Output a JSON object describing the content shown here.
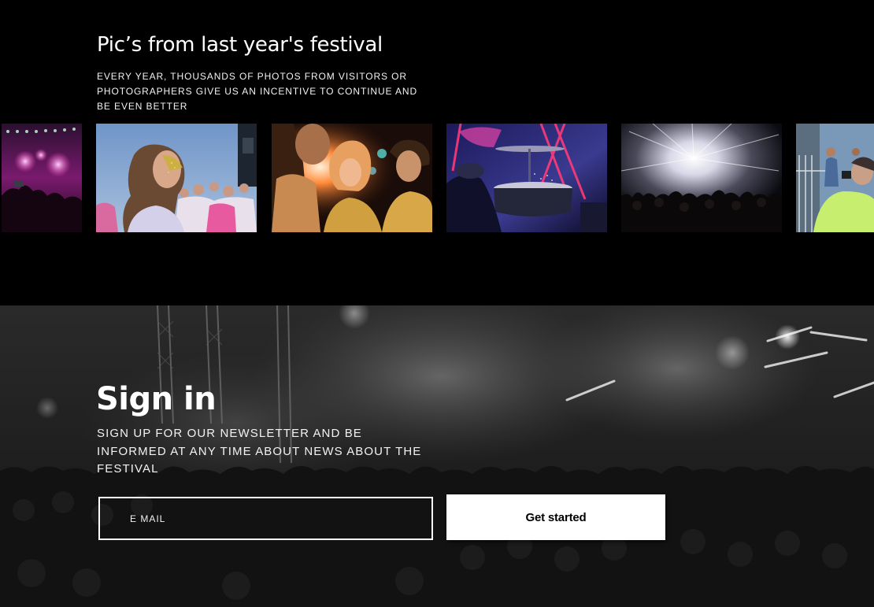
{
  "gallery": {
    "title": "Pic’s from last year's festival",
    "subtitle": "EVERY YEAR, THOUSANDS OF PHOTOS FROM VISITORS OR PHOTOGRAPHERS GIVE US AN INCENTIVE TO CONTINUE AND BE EVEN BETTER",
    "photos": [
      "concert-stage-photo",
      "festival-girl-photo",
      "dancing-friends-photo",
      "drummer-photo",
      "fireworks-crowd-photo",
      "balcony-crowd-photo"
    ]
  },
  "signin": {
    "title": "Sign in",
    "subtitle": "SIGN UP FOR OUR NEWSLETTER AND BE INFORMED AT ANY TIME ABOUT NEWS ABOUT THE FESTIVAL",
    "email_placeholder": "E MAIL",
    "button_label": "Get started"
  },
  "colors": {
    "background": "#000000",
    "text": "#ffffff",
    "button_background": "#ffffff",
    "button_text": "#000000"
  }
}
